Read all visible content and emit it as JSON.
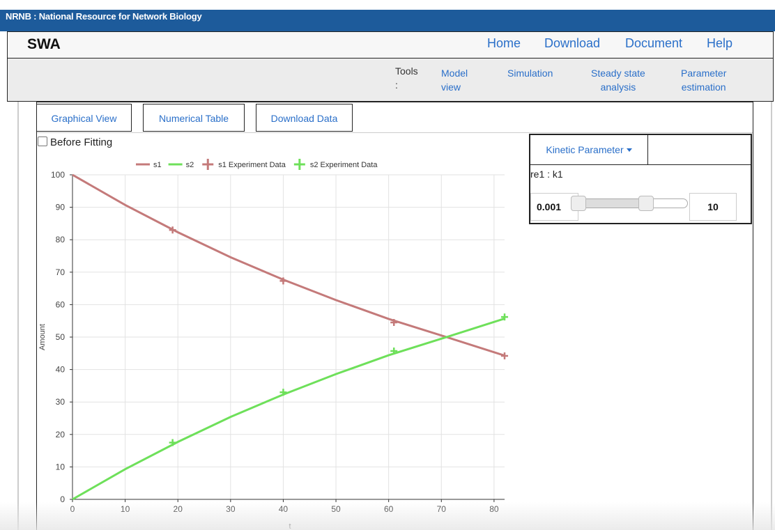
{
  "topbar": {
    "brand": "NRNB : National Resource for Network Biology"
  },
  "navbar": {
    "title": "SWA",
    "links": [
      "Home",
      "Download",
      "Document",
      "Help"
    ]
  },
  "toolbar": {
    "label": "Tools",
    "colon": ":",
    "tools": [
      {
        "line1": "Model",
        "line2": "view"
      },
      {
        "line1": "Simulation",
        "line2": ""
      },
      {
        "line1": "Steady state",
        "line2": "analysis"
      },
      {
        "line1": "Parameter",
        "line2": "estimation"
      }
    ]
  },
  "tabs": [
    "Graphical View",
    "Numerical Table",
    "Download Data"
  ],
  "before_fitting": {
    "label": "Before Fitting",
    "checked": false
  },
  "kinetic": {
    "button": "Kinetic Parameter",
    "param_name": "re1 : k1",
    "min": "0.001",
    "max": "10",
    "slider_position": 0.55
  },
  "colors": {
    "accent": "#2a6fc9",
    "header": "#1d5b9b",
    "s1": "#c47a7a",
    "s2": "#6ee05a"
  },
  "chart_data": {
    "type": "line",
    "xlabel": "t",
    "ylabel": "Amount",
    "xlim": [
      0,
      82
    ],
    "ylim": [
      0,
      100
    ],
    "xticks": [
      0,
      10,
      20,
      30,
      40,
      50,
      60,
      70,
      80
    ],
    "yticks": [
      0,
      10,
      20,
      30,
      40,
      50,
      60,
      70,
      80,
      90,
      100
    ],
    "grid": true,
    "legend_position": "top",
    "series": [
      {
        "name": "s1",
        "kind": "line",
        "color": "#c47a7a",
        "x": [
          0,
          10,
          20,
          30,
          40,
          50,
          60,
          70,
          82
        ],
        "y": [
          100,
          90.7,
          82.3,
          74.6,
          67.7,
          61.4,
          55.6,
          50.5,
          44.3
        ]
      },
      {
        "name": "s2",
        "kind": "line",
        "color": "#6ee05a",
        "x": [
          0,
          10,
          20,
          30,
          40,
          50,
          60,
          70,
          82
        ],
        "y": [
          0,
          9.3,
          17.7,
          25.4,
          32.3,
          38.6,
          44.4,
          49.5,
          55.7
        ]
      },
      {
        "name": "s1 Experiment Data",
        "kind": "marker",
        "color": "#c47a7a",
        "x": [
          19,
          40,
          61,
          82
        ],
        "y": [
          83,
          67.3,
          54.5,
          44.2
        ]
      },
      {
        "name": "s2 Experiment Data",
        "kind": "marker",
        "color": "#6ee05a",
        "x": [
          19,
          40,
          61,
          82
        ],
        "y": [
          17.5,
          33,
          45.7,
          56.2
        ]
      }
    ]
  }
}
